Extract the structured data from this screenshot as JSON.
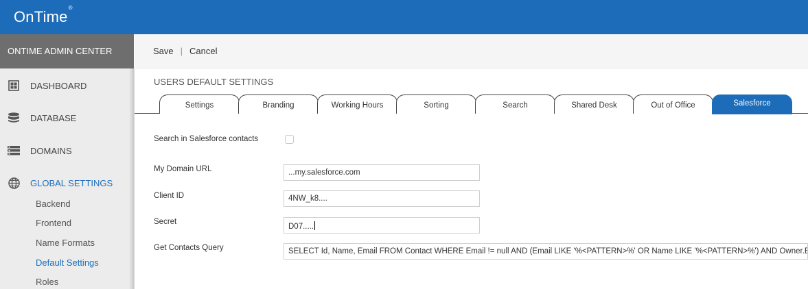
{
  "app": {
    "logo": "OnTime",
    "logo_mark": "®"
  },
  "sidebar": {
    "header": "ONTIME ADMIN CENTER",
    "items": [
      {
        "label": "DASHBOARD",
        "icon": "dashboard-icon"
      },
      {
        "label": "DATABASE",
        "icon": "database-icon"
      },
      {
        "label": "DOMAINS",
        "icon": "domains-icon"
      },
      {
        "label": "GLOBAL SETTINGS",
        "icon": "globe-icon"
      }
    ],
    "sub_items": [
      "Backend",
      "Frontend",
      "Name Formats",
      "Default Settings",
      "Roles"
    ],
    "active_sub_item": "Default Settings"
  },
  "toolbar": {
    "save_label": "Save",
    "separator": "|",
    "cancel_label": "Cancel"
  },
  "section_title": "USERS DEFAULT SETTINGS",
  "tabs": [
    "Settings",
    "Branding",
    "Working Hours",
    "Sorting",
    "Search",
    "Shared Desk",
    "Out of Office",
    "Salesforce"
  ],
  "active_tab": "Salesforce",
  "form": {
    "search_contacts_label": "Search in Salesforce contacts",
    "search_contacts_checked": false,
    "domain_url_label": "My Domain URL",
    "domain_url_value": "...my.salesforce.com",
    "client_id_label": "Client ID",
    "client_id_value": "4NW_k8....",
    "secret_label": "Secret",
    "secret_value": "D07.....",
    "query_label": "Get Contacts Query",
    "query_value": "SELECT Id, Name, Email FROM Contact WHERE Email != null AND (Email LIKE '%<PATTERN>%' OR Name LIKE '%<PATTERN>%') AND Owner.Em"
  },
  "colors": {
    "brand": "#1c6cb9",
    "sidebar_bg": "#ececec",
    "admin_header_bg": "#6e6e6e"
  }
}
